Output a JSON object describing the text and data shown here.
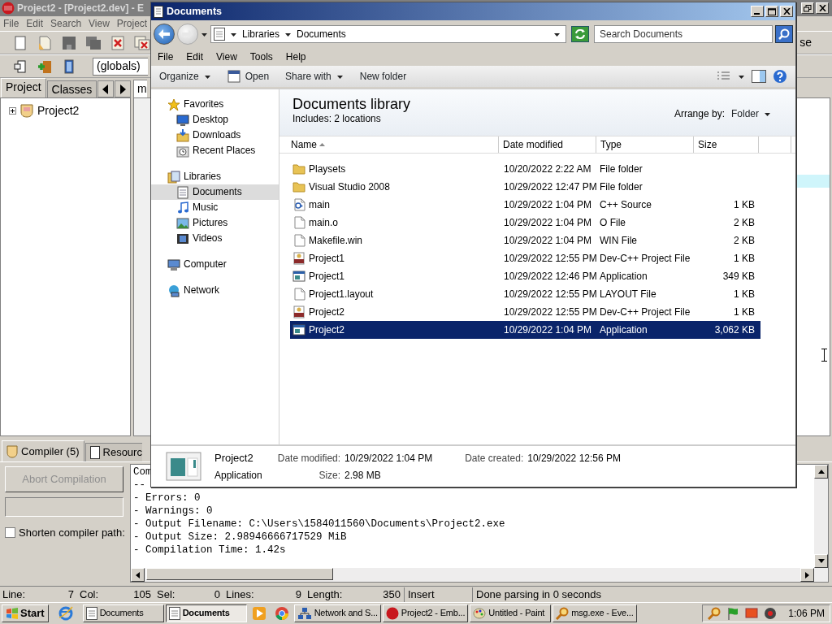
{
  "devcpp": {
    "title": "Project2 - [Project2.dev] - E",
    "menu": [
      "File",
      "Edit",
      "Search",
      "View",
      "Project"
    ],
    "scope": "(globals)",
    "panel_tabs": [
      {
        "label": "Project",
        "selected": true
      },
      {
        "label": "Classes",
        "selected": false
      }
    ],
    "editor_tab": "m",
    "tree": [
      {
        "label": "Project2",
        "expanded": false
      }
    ],
    "toolbar_text": "se",
    "bottom_tabs": [
      {
        "label": "Compiler (5)",
        "selected": true
      },
      {
        "label": "Resourc",
        "selected": false
      }
    ],
    "progress": {
      "level": 0
    },
    "abort_button": {
      "label": "Abort Compilation",
      "disabled": true
    },
    "shorten_paths": {
      "label": "Shorten compiler path:",
      "checked": false
    },
    "output": [
      "Com",
      "--",
      "- Errors: 0",
      "- Warnings: 0",
      "- Output Filename: C:\\Users\\1584011560\\Documents\\Project2.exe",
      "- Output Size: 2.98946666717529 MiB",
      "- Compilation Time: 1.42s"
    ],
    "status": [
      {
        "label": "Line:",
        "value": "7"
      },
      {
        "label": "Col:",
        "value": "105"
      },
      {
        "label": "Sel:",
        "value": "0"
      },
      {
        "label": "Lines:",
        "value": "9"
      },
      {
        "label": "Length:",
        "value": "350"
      }
    ],
    "mode": "Insert",
    "message": "Done parsing in 0 seconds"
  },
  "explorer": {
    "title": "Documents",
    "breadcrumb": [
      "Libraries",
      "Documents"
    ],
    "search_placeholder": "Search Documents",
    "menu": [
      "File",
      "Edit",
      "View",
      "Tools",
      "Help"
    ],
    "commands": [
      {
        "label": "Organize",
        "dropdown": true
      },
      {
        "label": "Open",
        "dropdown": false
      },
      {
        "label": "Share with",
        "dropdown": true
      },
      {
        "label": "New folder",
        "dropdown": false
      }
    ],
    "nav": [
      {
        "label": "Favorites",
        "children": [
          {
            "label": "Desktop",
            "selected": false
          },
          {
            "label": "Downloads",
            "selected": false
          },
          {
            "label": "Recent Places",
            "selected": false
          }
        ]
      },
      {
        "label": "Libraries",
        "children": [
          {
            "label": "Documents",
            "selected": true
          },
          {
            "label": "Music",
            "selected": false
          },
          {
            "label": "Pictures",
            "selected": false
          },
          {
            "label": "Videos",
            "selected": false
          }
        ]
      },
      {
        "label": "Computer"
      },
      {
        "label": "Network"
      }
    ],
    "library_title": "Documents library",
    "includes": "Includes:  2 locations",
    "arrange_label": "Arrange by:",
    "arrange_value": "Folder",
    "columns": [
      {
        "label": "Name",
        "sorted": true
      },
      {
        "label": "Date modified",
        "sorted": false
      },
      {
        "label": "Type",
        "sorted": false
      },
      {
        "label": "Size",
        "sorted": false
      }
    ],
    "files": [
      {
        "name": "Playsets",
        "date": "10/20/2022 2:22 AM",
        "type": "File folder",
        "kind": "folder",
        "selected": false
      },
      {
        "name": "Visual Studio 2008",
        "date": "10/29/2022 12:47 PM",
        "type": "File folder",
        "kind": "folder",
        "selected": false
      },
      {
        "name": "main",
        "date": "10/29/2022 1:04 PM",
        "type": "C++ Source",
        "size": "1 KB",
        "kind": "source",
        "selected": false
      },
      {
        "name": "main.o",
        "date": "10/29/2022 1:04 PM",
        "type": "O File",
        "size": "2 KB",
        "kind": "file",
        "selected": false
      },
      {
        "name": "Makefile.win",
        "date": "10/29/2022 1:04 PM",
        "type": "WIN File",
        "size": "2 KB",
        "kind": "file",
        "selected": false
      },
      {
        "name": "Project1",
        "date": "10/29/2022 12:55 PM",
        "type": "Dev-C++ Project File",
        "size": "1 KB",
        "kind": "project",
        "selected": false
      },
      {
        "name": "Project1",
        "date": "10/29/2022 12:46 PM",
        "type": "Application",
        "size": "349 KB",
        "kind": "app",
        "selected": false
      },
      {
        "name": "Project1.layout",
        "date": "10/29/2022 12:55 PM",
        "type": "LAYOUT File",
        "size": "1 KB",
        "kind": "file",
        "selected": false
      },
      {
        "name": "Project2",
        "date": "10/29/2022 12:55 PM",
        "type": "Dev-C++ Project File",
        "size": "1 KB",
        "kind": "project",
        "selected": false
      },
      {
        "name": "Project2",
        "date": "10/29/2022 1:04 PM",
        "type": "Application",
        "size": "3,062 KB",
        "kind": "app",
        "selected": true
      }
    ],
    "details": {
      "name": "Project2",
      "type": "Application",
      "fields": [
        {
          "label": "Date modified:",
          "value": "10/29/2022 1:04 PM"
        },
        {
          "label": "Date created:",
          "value": "10/29/2022 12:56 PM"
        },
        {
          "label": "Size:",
          "value": "2.98 MB"
        }
      ]
    }
  },
  "taskbar": {
    "start": "Start",
    "items": [
      {
        "kind": "launcher"
      },
      {
        "kind": "window",
        "label": "Documents",
        "selected": false
      },
      {
        "kind": "window",
        "label": "Documents",
        "selected": true
      },
      {
        "kind": "launcher"
      },
      {
        "kind": "launcher"
      },
      {
        "kind": "window",
        "label": "Network and S...",
        "selected": false
      },
      {
        "kind": "window",
        "label": "Project2 - Emb...",
        "selected": false
      },
      {
        "kind": "window",
        "label": "Untitled - Paint",
        "selected": false
      },
      {
        "kind": "window",
        "label": "msg.exe - Eve...",
        "selected": false
      }
    ],
    "clock": "1:06 PM"
  }
}
